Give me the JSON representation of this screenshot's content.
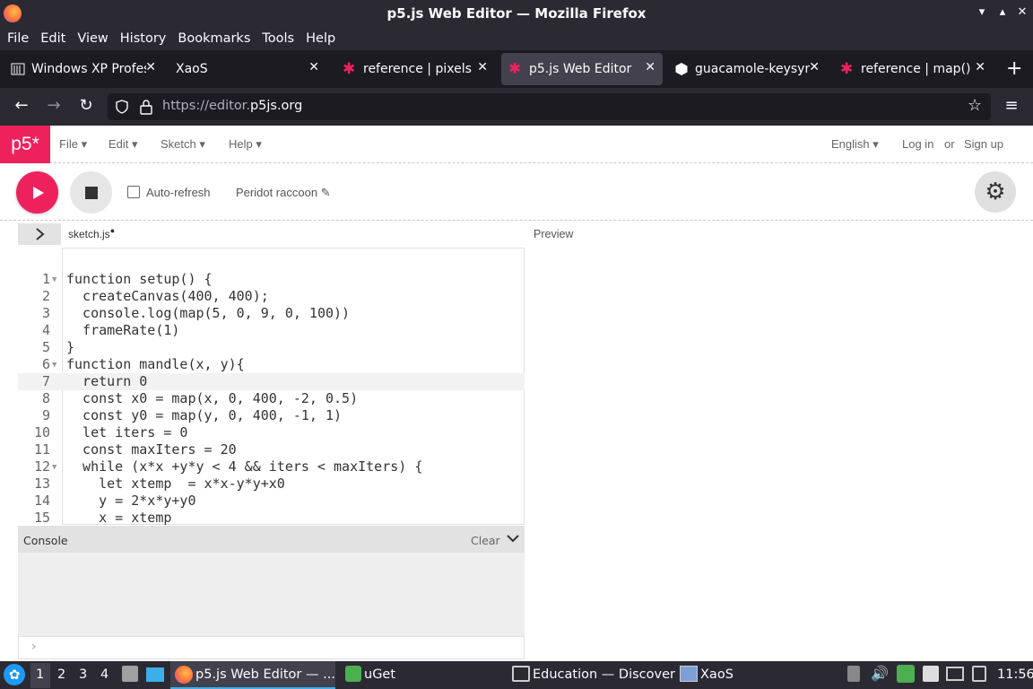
{
  "window": {
    "title": "p5.js Web Editor — Mozilla Firefox"
  },
  "menubar": [
    "File",
    "Edit",
    "View",
    "History",
    "Bookmarks",
    "Tools",
    "Help"
  ],
  "tabs": [
    {
      "label": "Windows XP Profes",
      "icon": "windows-icon",
      "active": false
    },
    {
      "label": "XaoS",
      "icon": "",
      "active": false
    },
    {
      "label": "reference | pixels",
      "icon": "p5-star-icon",
      "active": false
    },
    {
      "label": "p5.js Web Editor",
      "icon": "p5-star-icon",
      "active": true
    },
    {
      "label": "guacamole-keysym",
      "icon": "hexagon-icon",
      "active": false
    },
    {
      "label": "reference | map()",
      "icon": "p5-star-icon",
      "active": false
    }
  ],
  "url": {
    "prefix": "https://editor.",
    "domain": "p5js.org"
  },
  "p5": {
    "logo": "p5*",
    "menus": [
      "File",
      "Edit",
      "Sketch",
      "Help"
    ],
    "lang": "English",
    "login": "Log in",
    "or": "or",
    "signup": "Sign up",
    "autorefresh": "Auto-refresh",
    "sketch_name": "Peridot raccoon",
    "file_tab": "sketch.js",
    "preview": "Preview",
    "console": "Console",
    "clear": "Clear"
  },
  "code": [
    {
      "n": "1",
      "fold": true,
      "t": "function setup() {"
    },
    {
      "n": "2",
      "t": "  createCanvas(400, 400);"
    },
    {
      "n": "3",
      "t": "  console.log(map(5, 0, 9, 0, 100))"
    },
    {
      "n": "4",
      "t": "  frameRate(1)"
    },
    {
      "n": "5",
      "t": "}"
    },
    {
      "n": "6",
      "fold": true,
      "t": "function mandle(x, y){"
    },
    {
      "n": "7",
      "t": "  return 0",
      "active": true
    },
    {
      "n": "8",
      "t": "  const x0 = map(x, 0, 400, -2, 0.5)"
    },
    {
      "n": "9",
      "t": "  const y0 = map(y, 0, 400, -1, 1)"
    },
    {
      "n": "10",
      "t": "  let iters = 0"
    },
    {
      "n": "11",
      "t": "  const maxIters = 20"
    },
    {
      "n": "12",
      "fold": true,
      "t": "  while (x*x +y*y < 4 && iters < maxIters) {"
    },
    {
      "n": "13",
      "t": "    let xtemp  = x*x-y*y+x0"
    },
    {
      "n": "14",
      "t": "    y = 2*x*y+y0"
    },
    {
      "n": "15",
      "t": "    x = xtemp"
    }
  ],
  "taskbar": {
    "workspaces": [
      "1",
      "2",
      "3",
      "4"
    ],
    "apps": [
      {
        "label": "p5.js Web Editor — ..."
      },
      {
        "label": "uGet"
      },
      {
        "label": "Education — Discover"
      },
      {
        "label": "XaoS"
      }
    ],
    "clock": "11:56"
  }
}
